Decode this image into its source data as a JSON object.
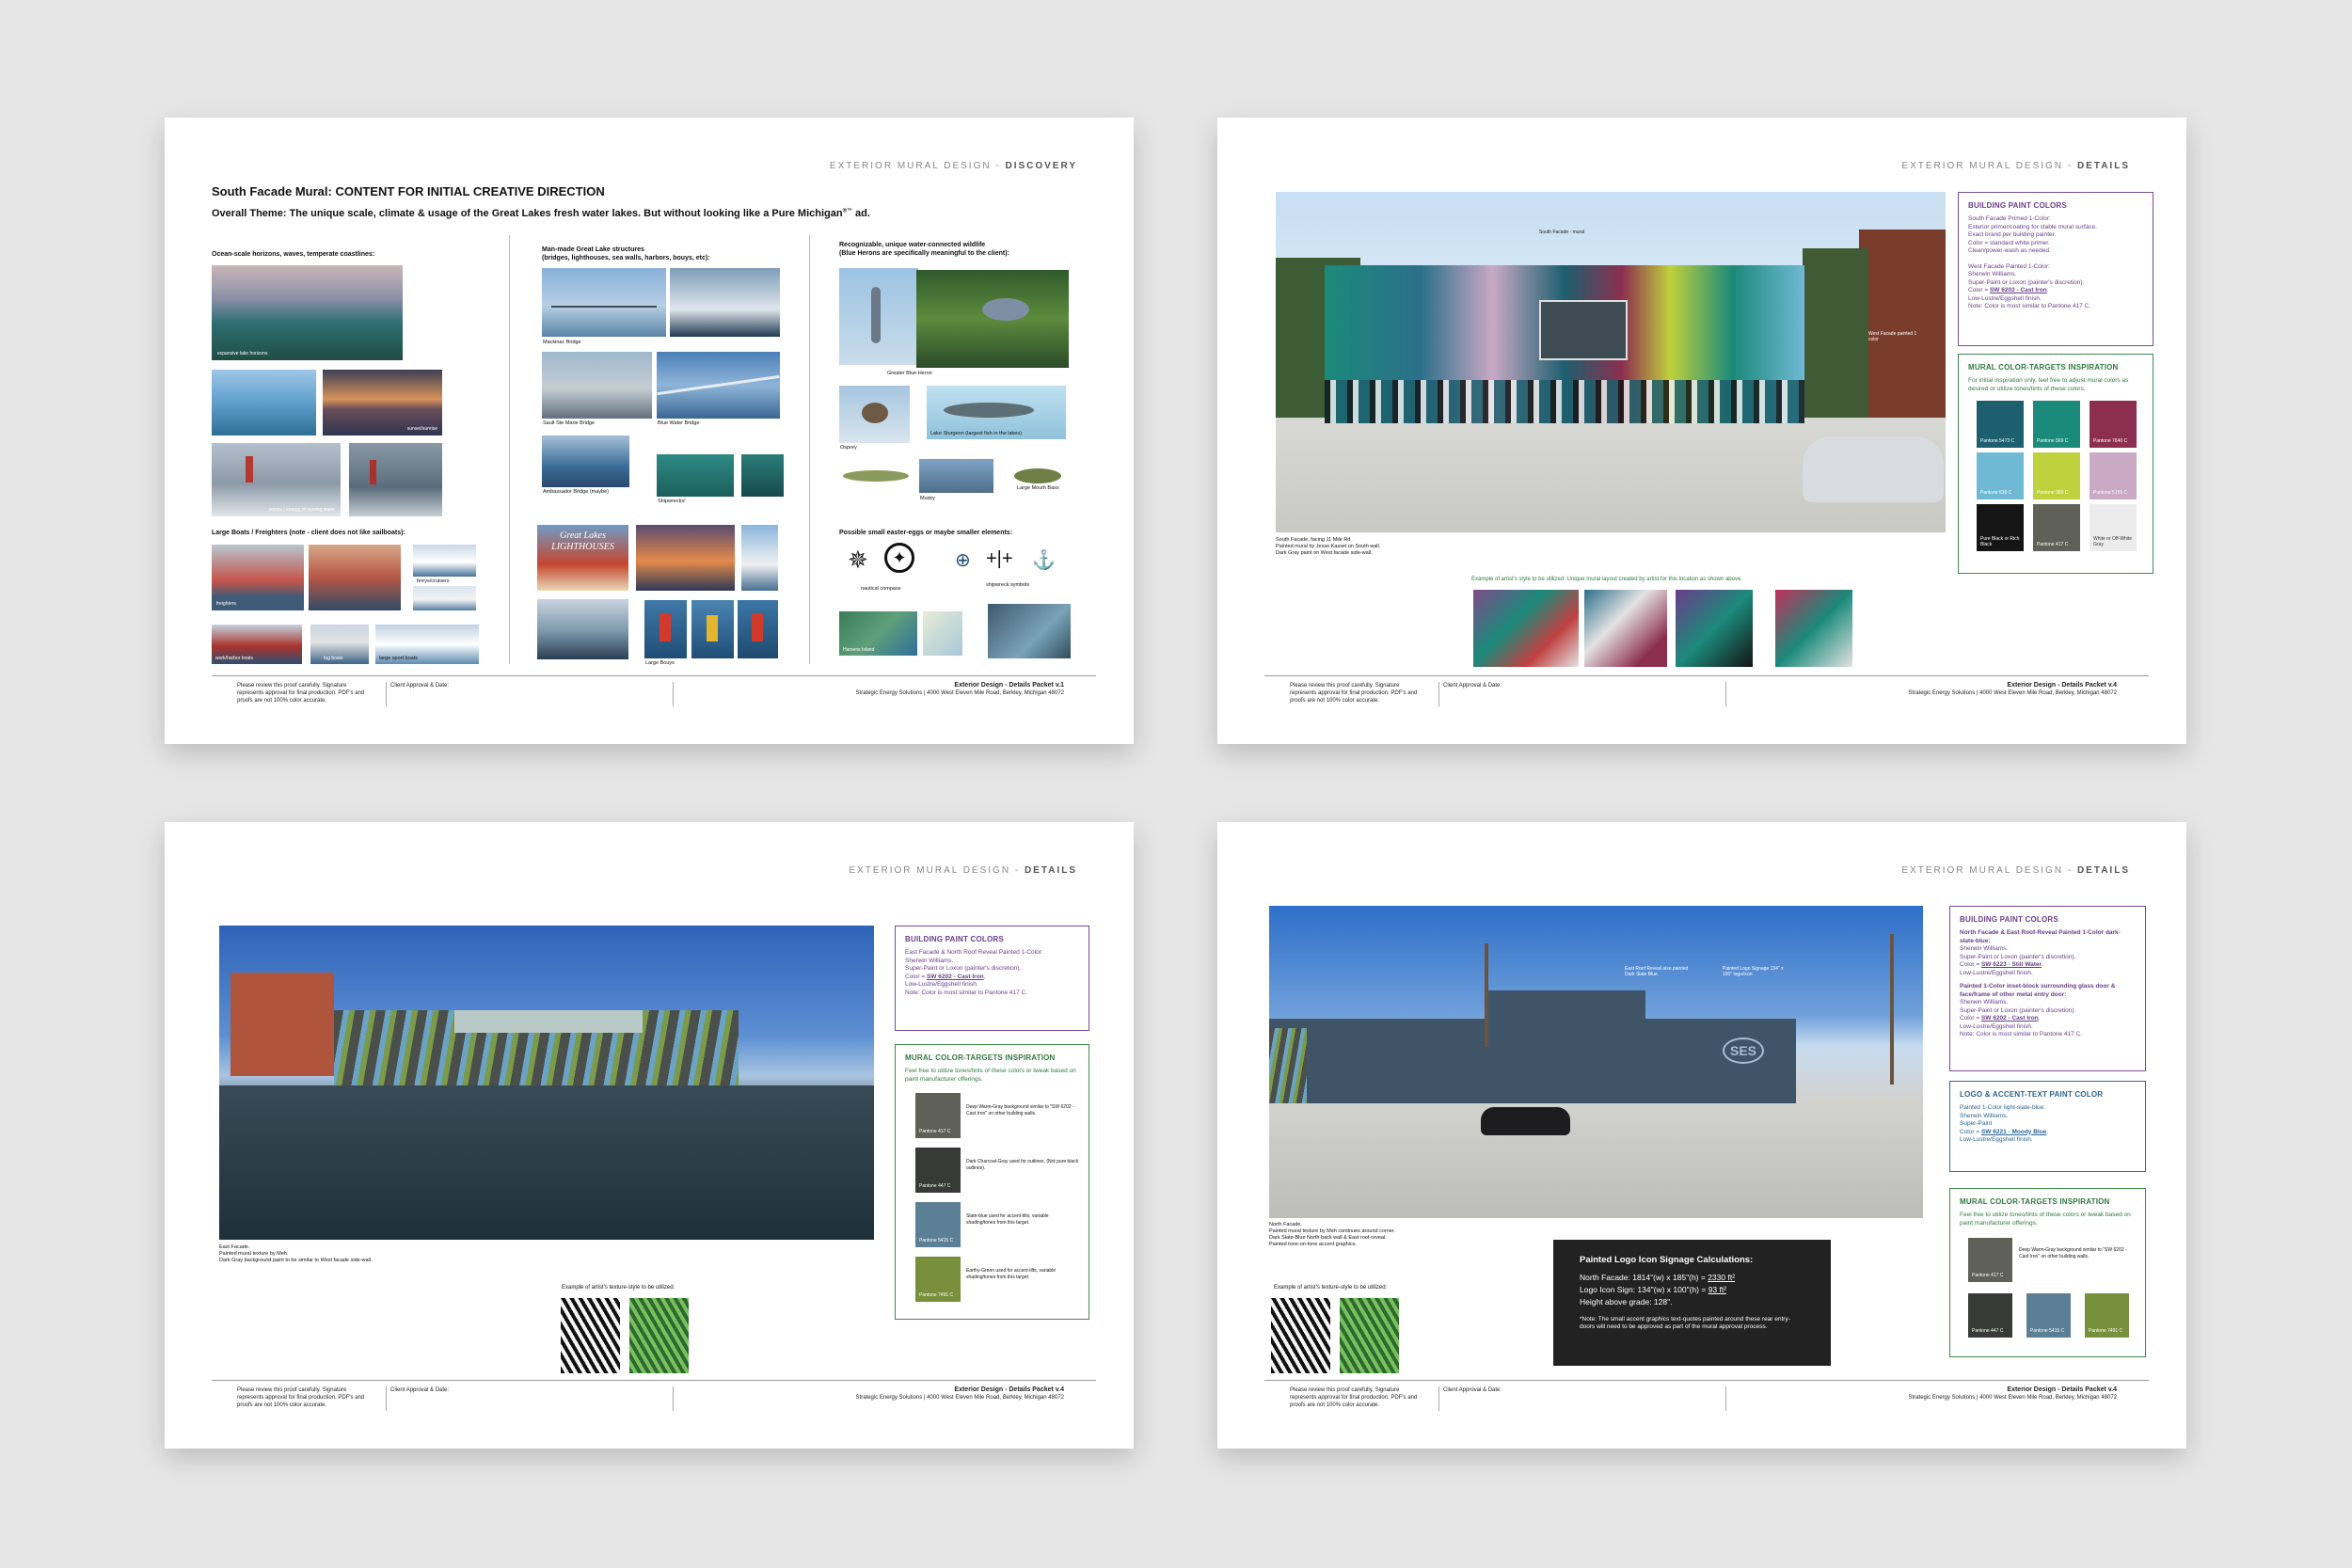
{
  "footer": {
    "note": "Please review this proof carefully. Signature represents approval for final production. PDF's and proofs are not 100% color accurate.",
    "approval": "Client Approval & Date:",
    "company": "Strategic Energy Solutions  |  4000 West Eleven Mile Road, Berkley, Michigan 48072"
  },
  "sheet1": {
    "header_prefix": "EXTERIOR MURAL DESIGN - ",
    "header_section": "DISCOVERY",
    "title": "South Facade Mural: CONTENT FOR INITIAL CREATIVE DIRECTION",
    "theme": "Overall Theme: The unique scale, climate & usage of the Great Lakes fresh water lakes. But without looking like a Pure Michigan",
    "theme_sup": "®™",
    "theme_end": " ad.",
    "col1_label": "Ocean-scale horizons, waves, temperate coastlines:",
    "col1_caps": [
      "expansive lake horizons",
      "sunset/sunrise",
      "waves / energy of moving water"
    ],
    "boats_label": "Large Boats / Freighters (note - client does not like sailboats):",
    "boat_caps": [
      "ferrys/cruisers",
      "freighters",
      "work/harbor boats",
      "tug boats",
      "large sport boats"
    ],
    "col2_label": "Man-made Great Lake structures\n(bridges, lighthouses, sea walls, harbors, bouys, etc):",
    "col2_caps": [
      "Mackinac Bridge",
      "Sault Ste Marie Bridge",
      "Blue Water Bridge",
      "Ambassador Bridge (maybe)",
      "Shipwrecks!",
      "Large Bouys"
    ],
    "lighthouse_text": "Great Lakes LIGHTHOUSES",
    "col3_label": "Recognizable, unique water-connected wildlife\n(Blue Herons are specifically meaningful to the client):",
    "col3_caps": [
      "Greater Blue Heron",
      "Osprey",
      "Lake Sturgeon (largest fish in the lakes)",
      "Musky",
      "Large Mouth Bass"
    ],
    "eggs_label": "Possible small easter-eggs or maybe smaller elements:",
    "eggs_caps": [
      "nautical compass",
      "shipwreck symbols",
      "Harsens Island"
    ],
    "footer_packet": "Exterior Design - Details Packet v.1"
  },
  "sheet2": {
    "header_prefix": "EXTERIOR MURAL DESIGN - ",
    "header_section": "DETAILS",
    "photo_label_top": "South Facade - mural",
    "photo_label_side": "West Facade painted 1 color",
    "caption": "South Facade, facing 11 Mile Rd\nPainted mural by Jesse Kassel on South wall.\nDark Gray paint on West facade side-wall.",
    "example_label": "Example of artist's style to be utilized: Unique mural layout created by artist for this location as shown above.",
    "paint_title": "BUILDING PAINT COLORS",
    "paint_text_1": "South Facade Primed 1-Color:\nExterior primer/coating for stable mural surface.\nExact brand per building painter.\nColor = standard white primer.\nClean/power-wash as needed.",
    "paint_text_2a": "West Facade Painted 1-Color:\nSherwin Williams.\nSuper-Paint or Loxon (painter's discretion).\nColor = ",
    "paint_code": "SW 6202 - Cast Iron",
    "paint_text_2b": ".\nLow-Lustre/Eggshell finish.\nNote: Color is most similar to Pantone 417 C.",
    "targets_title": "MURAL COLOR-TARGETS INSPIRATION",
    "targets_text": "For initial inspiration only, feel free to adjust mural colors as desired or utilize tones/tints of these colors.",
    "swatches": [
      {
        "label": "Pantone 5473 C",
        "color": "#1d5f6e"
      },
      {
        "label": "Pantone 569 C",
        "color": "#1b8a7a"
      },
      {
        "label": "Pantone 7640 C",
        "color": "#8c2f4f"
      },
      {
        "label": "Pantone 630 C",
        "color": "#6fb9d4"
      },
      {
        "label": "Pantone 380 C",
        "color": "#bfd13c"
      },
      {
        "label": "Pantone 5155 C",
        "color": "#c9a9c4"
      },
      {
        "label": "Pure Black or Rich Black",
        "color": "#151515"
      },
      {
        "label": "Pantone 417 C",
        "color": "#5f6058"
      },
      {
        "label": "White or Off-White Gray",
        "color": "#ececec"
      }
    ],
    "footer_packet": "Exterior Design - Details Packet v.4"
  },
  "sheet3": {
    "header_prefix": "EXTERIOR MURAL DESIGN - ",
    "header_section": "DETAILS",
    "caption": "East Facade.\nPainted mural texture by Meh.\nDark Gray background paint to be similar to West facade side-wall.",
    "example_label": "Example of artist's texture-style to be utilized:",
    "paint_title": "BUILDING PAINT COLORS",
    "paint_text_a": "East Facade & North Roof Reveal Painted 1-Color:\nSherwin Williams.\nSuper-Paint or Loxon (painter's discretion).\nColor = ",
    "paint_code": "SW 6202 - Cast Iron",
    "paint_text_b": ".\nLow-Lustre/Eggshell finish.\nNote: Color is most similar to Pantone 417 C.",
    "targets_title": "MURAL COLOR-TARGETS INSPIRATION",
    "targets_text": "Feel free to utilize tones/tints of these colors or tweak based on paint manufacturer offerings.",
    "swatches": [
      {
        "label": "Pantone 417 C",
        "color": "#5f6058",
        "note": "Deep Warm-Gray background similar to \"SW 6202 - Cast Iron\" on other building walls."
      },
      {
        "label": "Pantone 447 C",
        "color": "#373a36",
        "note": "Dark Charcoal-Gray used for outlines, (Not pure black outlines)."
      },
      {
        "label": "Pantone 5415 C",
        "color": "#5b7f95",
        "note": "Slate-blue used for accent-tilts, variable shading/tones from this target."
      },
      {
        "label": "Pantone 7491 C",
        "color": "#78903b",
        "note": "Earthy-Green used for accent-tilts, variable shading/tones from this target."
      }
    ],
    "footer_packet": "Exterior Design - Details Packet v.4"
  },
  "sheet4": {
    "header_prefix": "EXTERIOR MURAL DESIGN - ",
    "header_section": "DETAILS",
    "photo_label_1": "East Roof Reveal also painted Dark Slate Blue.",
    "photo_label_2": "Painted Logo Signage 134\" x 100\" logo/icon",
    "logo_text": "SES",
    "caption": "North Facade.\nPainted mural texture by Meh continues around corner.\nDark Slate-Blue North back wall & East roof-reveal.\nPainted tone-on-tone accent graphics.",
    "example_label": "Example of artist's texture-style to be utilized:",
    "calc_title": "Painted Logo Icon Signage Calculations:",
    "calc_line1": "North Facade: 1814\"(w) x 185\"(h) = ",
    "calc_val1": "2330 ft²",
    "calc_line2": "Logo Icon Sign: 134\"(w) x 100\"(h) = ",
    "calc_val2": "93 ft²",
    "calc_line3": "Height above grade: 128\".",
    "calc_note": "*Note: The small accent graphics text-quotes painted around these rear entry-doors will need to be approved as part of the mural approval process.",
    "paint_title": "BUILDING PAINT COLORS",
    "paint_bold1": "North Facade & East Roof-Reveal Painted 1-Color dark-slate-blue:",
    "paint_text_1a": "Sherwin Williams.\nSuper-Paint or Loxon (painter's discretion).\nColor = ",
    "paint_code_1": "SW 6223 - Still Water",
    "paint_text_1b": ".\nLow-Lustre/Eggshell finish.",
    "paint_bold2": "Painted 1-Color inset-block surrounding glass door & face/frame of other metal entry door:",
    "paint_text_2a": "Sherwin Williams.\nSuper-Paint or Loxon (painter's discretion).\nColor = ",
    "paint_code_2": "SW 6202 - Cast Iron",
    "paint_text_2b": ".\nLow-Lustre/Eggshell finish.\nNote: Color is most similar to Pantone 417 C.",
    "logo_title": "LOGO & ACCENT-TEXT PAINT COLOR",
    "logo_text_a": "Painted 1-Color light-slate-blue:\nSherwin Williams.\nSuper-Paint\nColor = ",
    "logo_code": "SW 6221 - Moody Blue",
    "logo_text_b": ".\nLow-Lustre/Eggshell finish.",
    "targets_title": "MURAL COLOR-TARGETS INSPIRATION",
    "targets_text": "Feel free to utilize tones/tints of these colors or tweak based on paint manufacturer offerings.",
    "swatches": [
      {
        "label": "Pantone 417 C",
        "color": "#5f6058"
      },
      {
        "label": "Pantone 447 C",
        "color": "#373a36"
      },
      {
        "label": "Pantone 5415 C",
        "color": "#5b7f95"
      },
      {
        "label": "Pantone 7491 C",
        "color": "#78903b"
      }
    ],
    "swatch_note": "Deep Warm-Gray background similar to \"SW 6202 - Cast Iron\" on other building walls.",
    "footer_packet": "Exterior Design - Details Packet v.4"
  }
}
